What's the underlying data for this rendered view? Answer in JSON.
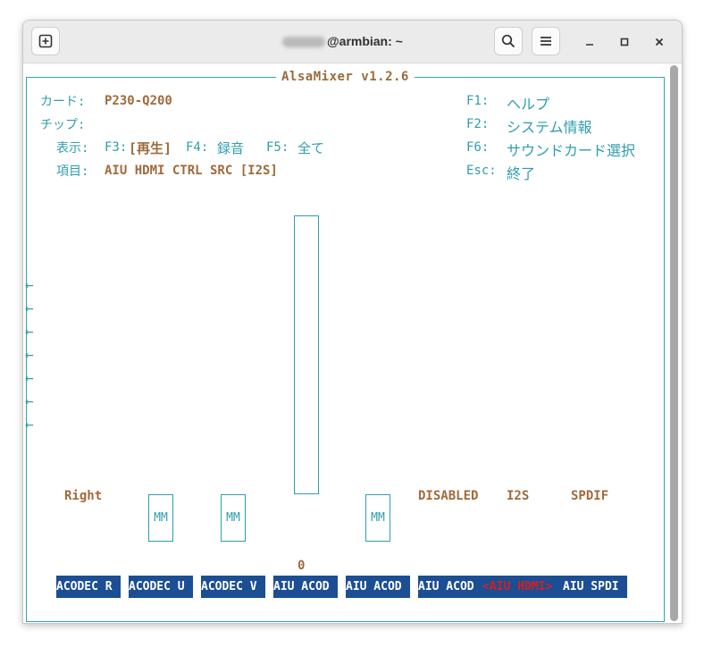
{
  "window": {
    "title_suffix": "@armbian: ~"
  },
  "mixer": {
    "title": "AlsaMixer v1.2.6",
    "card_label": "カード:",
    "card_value": "P230-Q200",
    "chip_label": "チップ:",
    "view_label": "表示:",
    "view_f3": "F3:",
    "view_f3_value": "[再生]",
    "view_f4": "F4:",
    "view_f4_value": "録音",
    "view_f5": "F5:",
    "view_f5_value": "全て",
    "item_label": "項目:",
    "item_value": "AIU HDMI CTRL SRC [I2S]",
    "help": [
      {
        "key": "F1:",
        "label": "ヘルプ"
      },
      {
        "key": "F2:",
        "label": "システム情報"
      },
      {
        "key": "F6:",
        "label": "サウンドカード選択"
      },
      {
        "key": "Esc:",
        "label": "終了"
      }
    ],
    "arrow_glyph": "←",
    "right_label": "Right",
    "mm_label": "MM",
    "disabled_label": "DISABLED",
    "i2s_label": "I2S",
    "spdif_label": "SPDIF",
    "value_zero": "0",
    "channels": [
      "ACODEC R",
      "ACODEC U",
      "ACODEC V",
      "AIU ACOD",
      "AIU ACOD",
      "AIU ACOD",
      "<AIU HDMI>",
      "AIU SPDI"
    ],
    "selected_index": 6
  }
}
